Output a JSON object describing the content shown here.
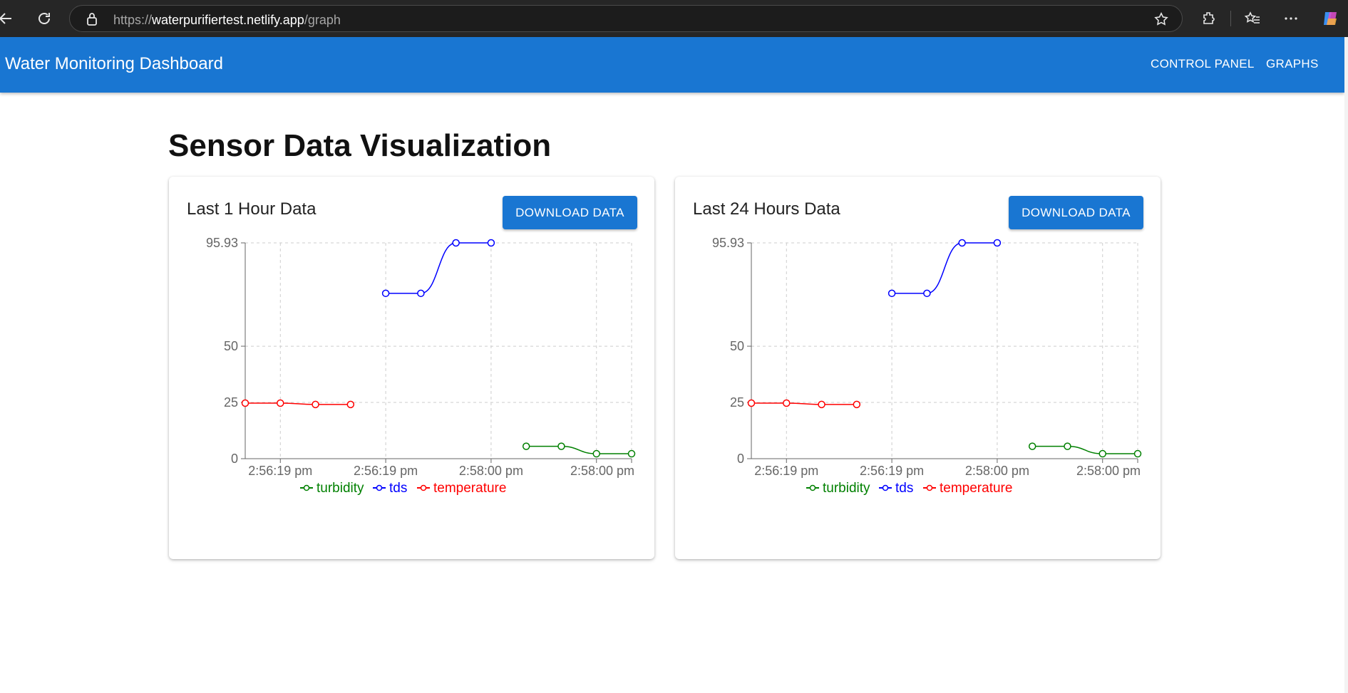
{
  "browser": {
    "url_scheme": "https://",
    "url_host": "waterpurifiertest.netlify.app",
    "url_path": "/graph"
  },
  "app": {
    "title": "Water Monitoring Dashboard",
    "nav": [
      "CONTROL PANEL",
      "GRAPHS"
    ]
  },
  "page": {
    "heading": "Sensor Data Visualization"
  },
  "cards": [
    {
      "title": "Last 1 Hour Data",
      "download_label": "DOWNLOAD DATA"
    },
    {
      "title": "Last 24 Hours Data",
      "download_label": "DOWNLOAD DATA"
    }
  ],
  "colors": {
    "app_bar": "#1976d2",
    "turbidity": "#008000",
    "tds": "#0000ff",
    "temperature": "#ff0000"
  },
  "chart_data": [
    {
      "type": "line",
      "categories": [
        "2:56:19 pm",
        "2:56:19 pm",
        "2:56:19 pm",
        "2:56:19 pm",
        "2:56:19 pm",
        "2:56:19 pm",
        "2:58:00 pm",
        "2:58:00 pm",
        "2:58:00 pm",
        "2:58:00 pm",
        "2:58:00 pm",
        "2:58:00 pm"
      ],
      "tick_labels": [
        "2:56:19 pm",
        "2:56:19 pm",
        "2:58:00 pm",
        "2:58:00 pm"
      ],
      "y_ticks": [
        "0",
        "25",
        "50",
        "95.93"
      ],
      "ylim": [
        0,
        95.93
      ],
      "grid": true,
      "legend_position": "bottom",
      "series": [
        {
          "name": "turbidity",
          "color": "#008000",
          "values": [
            null,
            null,
            null,
            null,
            null,
            null,
            null,
            null,
            5.5,
            5.5,
            2.2,
            2.2
          ]
        },
        {
          "name": "tds",
          "color": "#0000ff",
          "values": [
            null,
            null,
            null,
            null,
            73.5,
            73.5,
            95.93,
            95.93,
            null,
            null,
            null,
            null
          ]
        },
        {
          "name": "temperature",
          "color": "#ff0000",
          "values": [
            24.7,
            24.7,
            24.1,
            24.1,
            null,
            null,
            null,
            null,
            null,
            null,
            null,
            null
          ]
        }
      ]
    },
    {
      "type": "line",
      "categories": [
        "2:56:19 pm",
        "2:56:19 pm",
        "2:56:19 pm",
        "2:56:19 pm",
        "2:56:19 pm",
        "2:56:19 pm",
        "2:58:00 pm",
        "2:58:00 pm",
        "2:58:00 pm",
        "2:58:00 pm",
        "2:58:00 pm",
        "2:58:00 pm"
      ],
      "tick_labels": [
        "2:56:19 pm",
        "2:56:19 pm",
        "2:58:00 pm",
        "2:58:00 pm"
      ],
      "y_ticks": [
        "0",
        "25",
        "50",
        "95.93"
      ],
      "ylim": [
        0,
        95.93
      ],
      "grid": true,
      "legend_position": "bottom",
      "series": [
        {
          "name": "turbidity",
          "color": "#008000",
          "values": [
            null,
            null,
            null,
            null,
            null,
            null,
            null,
            null,
            5.5,
            5.5,
            2.2,
            2.2
          ]
        },
        {
          "name": "tds",
          "color": "#0000ff",
          "values": [
            null,
            null,
            null,
            null,
            73.5,
            73.5,
            95.93,
            95.93,
            null,
            null,
            null,
            null
          ]
        },
        {
          "name": "temperature",
          "color": "#ff0000",
          "values": [
            24.7,
            24.7,
            24.1,
            24.1,
            null,
            null,
            null,
            null,
            null,
            null,
            null,
            null
          ]
        }
      ]
    }
  ]
}
